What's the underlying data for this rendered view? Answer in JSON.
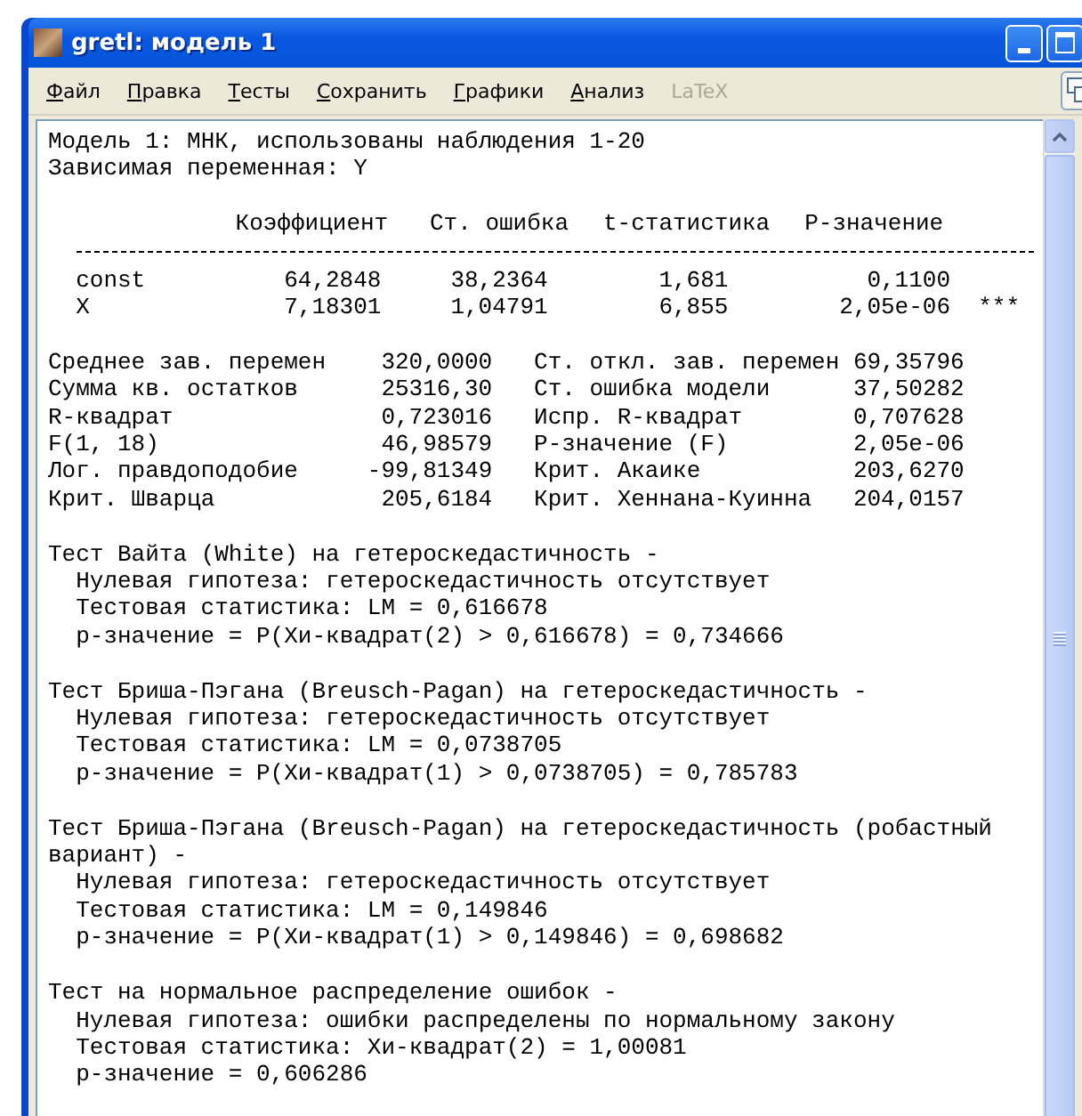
{
  "window": {
    "title": "gretl: модель 1"
  },
  "menu": [
    {
      "accel": "Ф",
      "rest": "айл",
      "disabled": false
    },
    {
      "accel": "П",
      "rest": "равка",
      "disabled": false
    },
    {
      "accel": "Т",
      "rest": "есты",
      "disabled": false
    },
    {
      "accel": "С",
      "rest": "охранить",
      "disabled": false
    },
    {
      "accel": "Г",
      "rest": "рафики",
      "disabled": false
    },
    {
      "accel": "А",
      "rest": "нализ",
      "disabled": false
    },
    {
      "rest": "LaTeX",
      "disabled": true
    }
  ],
  "header_lines": [
    "Модель 1: МНК, использованы наблюдения 1-20",
    "Зависимая переменная: Y"
  ],
  "coefficients": {
    "columns": [
      "Коэффициент",
      "Ст. ошибка",
      "t-статистика",
      "P-значение"
    ],
    "rows": [
      {
        "name": "const",
        "cells": [
          "64,2848",
          "38,2364",
          "1,681",
          "0,1100"
        ],
        "stars": ""
      },
      {
        "name": "X",
        "cells": [
          "7,18301",
          "1,04791",
          "6,855",
          "2,05e-06"
        ],
        "stars": "***"
      }
    ]
  },
  "stats": [
    {
      "label": "Среднее зав. перемен",
      "value": "320,0000",
      "label2": "Ст. откл. зав. перемен",
      "value2": "69,35796"
    },
    {
      "label": "Сумма кв. остатков",
      "value": "25316,30",
      "label2": "Ст. ошибка модели",
      "value2": "37,50282"
    },
    {
      "label": "R-квадрат",
      "value": "0,723016",
      "label2": "Испр. R-квадрат",
      "value2": "0,707628"
    },
    {
      "label": "F(1, 18)",
      "value": "46,98579",
      "label2": "P-значение (F)",
      "value2": "2,05e-06"
    },
    {
      "label": "Лог. правдоподобие",
      "value": "-99,81349",
      "label2": "Крит. Акаике",
      "value2": "203,6270"
    },
    {
      "label": "Крит. Шварца",
      "value": "205,6184",
      "label2": "Крит. Хеннана-Куинна",
      "value2": "204,0157"
    }
  ],
  "tests": [
    {
      "title": "Тест Вайта (White) на гетероскедастичность -",
      "lines": [
        "Нулевая гипотеза: гетероскедастичность отсутствует",
        "Тестовая статистика: LM = 0,616678",
        "p-значение = P(Хи-квадрат(2) > 0,616678) = 0,734666"
      ]
    },
    {
      "title": "Тест Бриша-Пэгана (Breusch-Pagan) на гетероскедастичность -",
      "lines": [
        "Нулевая гипотеза: гетероскедастичность отсутствует",
        "Тестовая статистика: LM = 0,0738705",
        "p-значение = P(Хи-квадрат(1) > 0,0738705) = 0,785783"
      ]
    },
    {
      "title": "Тест Бриша-Пэгана (Breusch-Pagan) на гетероскедастичность (робастный вариант) -",
      "lines": [
        "Нулевая гипотеза: гетероскедастичность отсутствует",
        "Тестовая статистика: LM = 0,149846",
        "p-значение = P(Хи-квадрат(1) > 0,149846) = 0,698682"
      ]
    },
    {
      "title": "Тест на нормальное распределение ошибок -",
      "lines": [
        "Нулевая гипотеза: ошибки распределены по нормальному закону",
        "Тестовая статистика: Хи-квадрат(2) = 1,00081",
        "p-значение = 0,606286"
      ]
    }
  ]
}
